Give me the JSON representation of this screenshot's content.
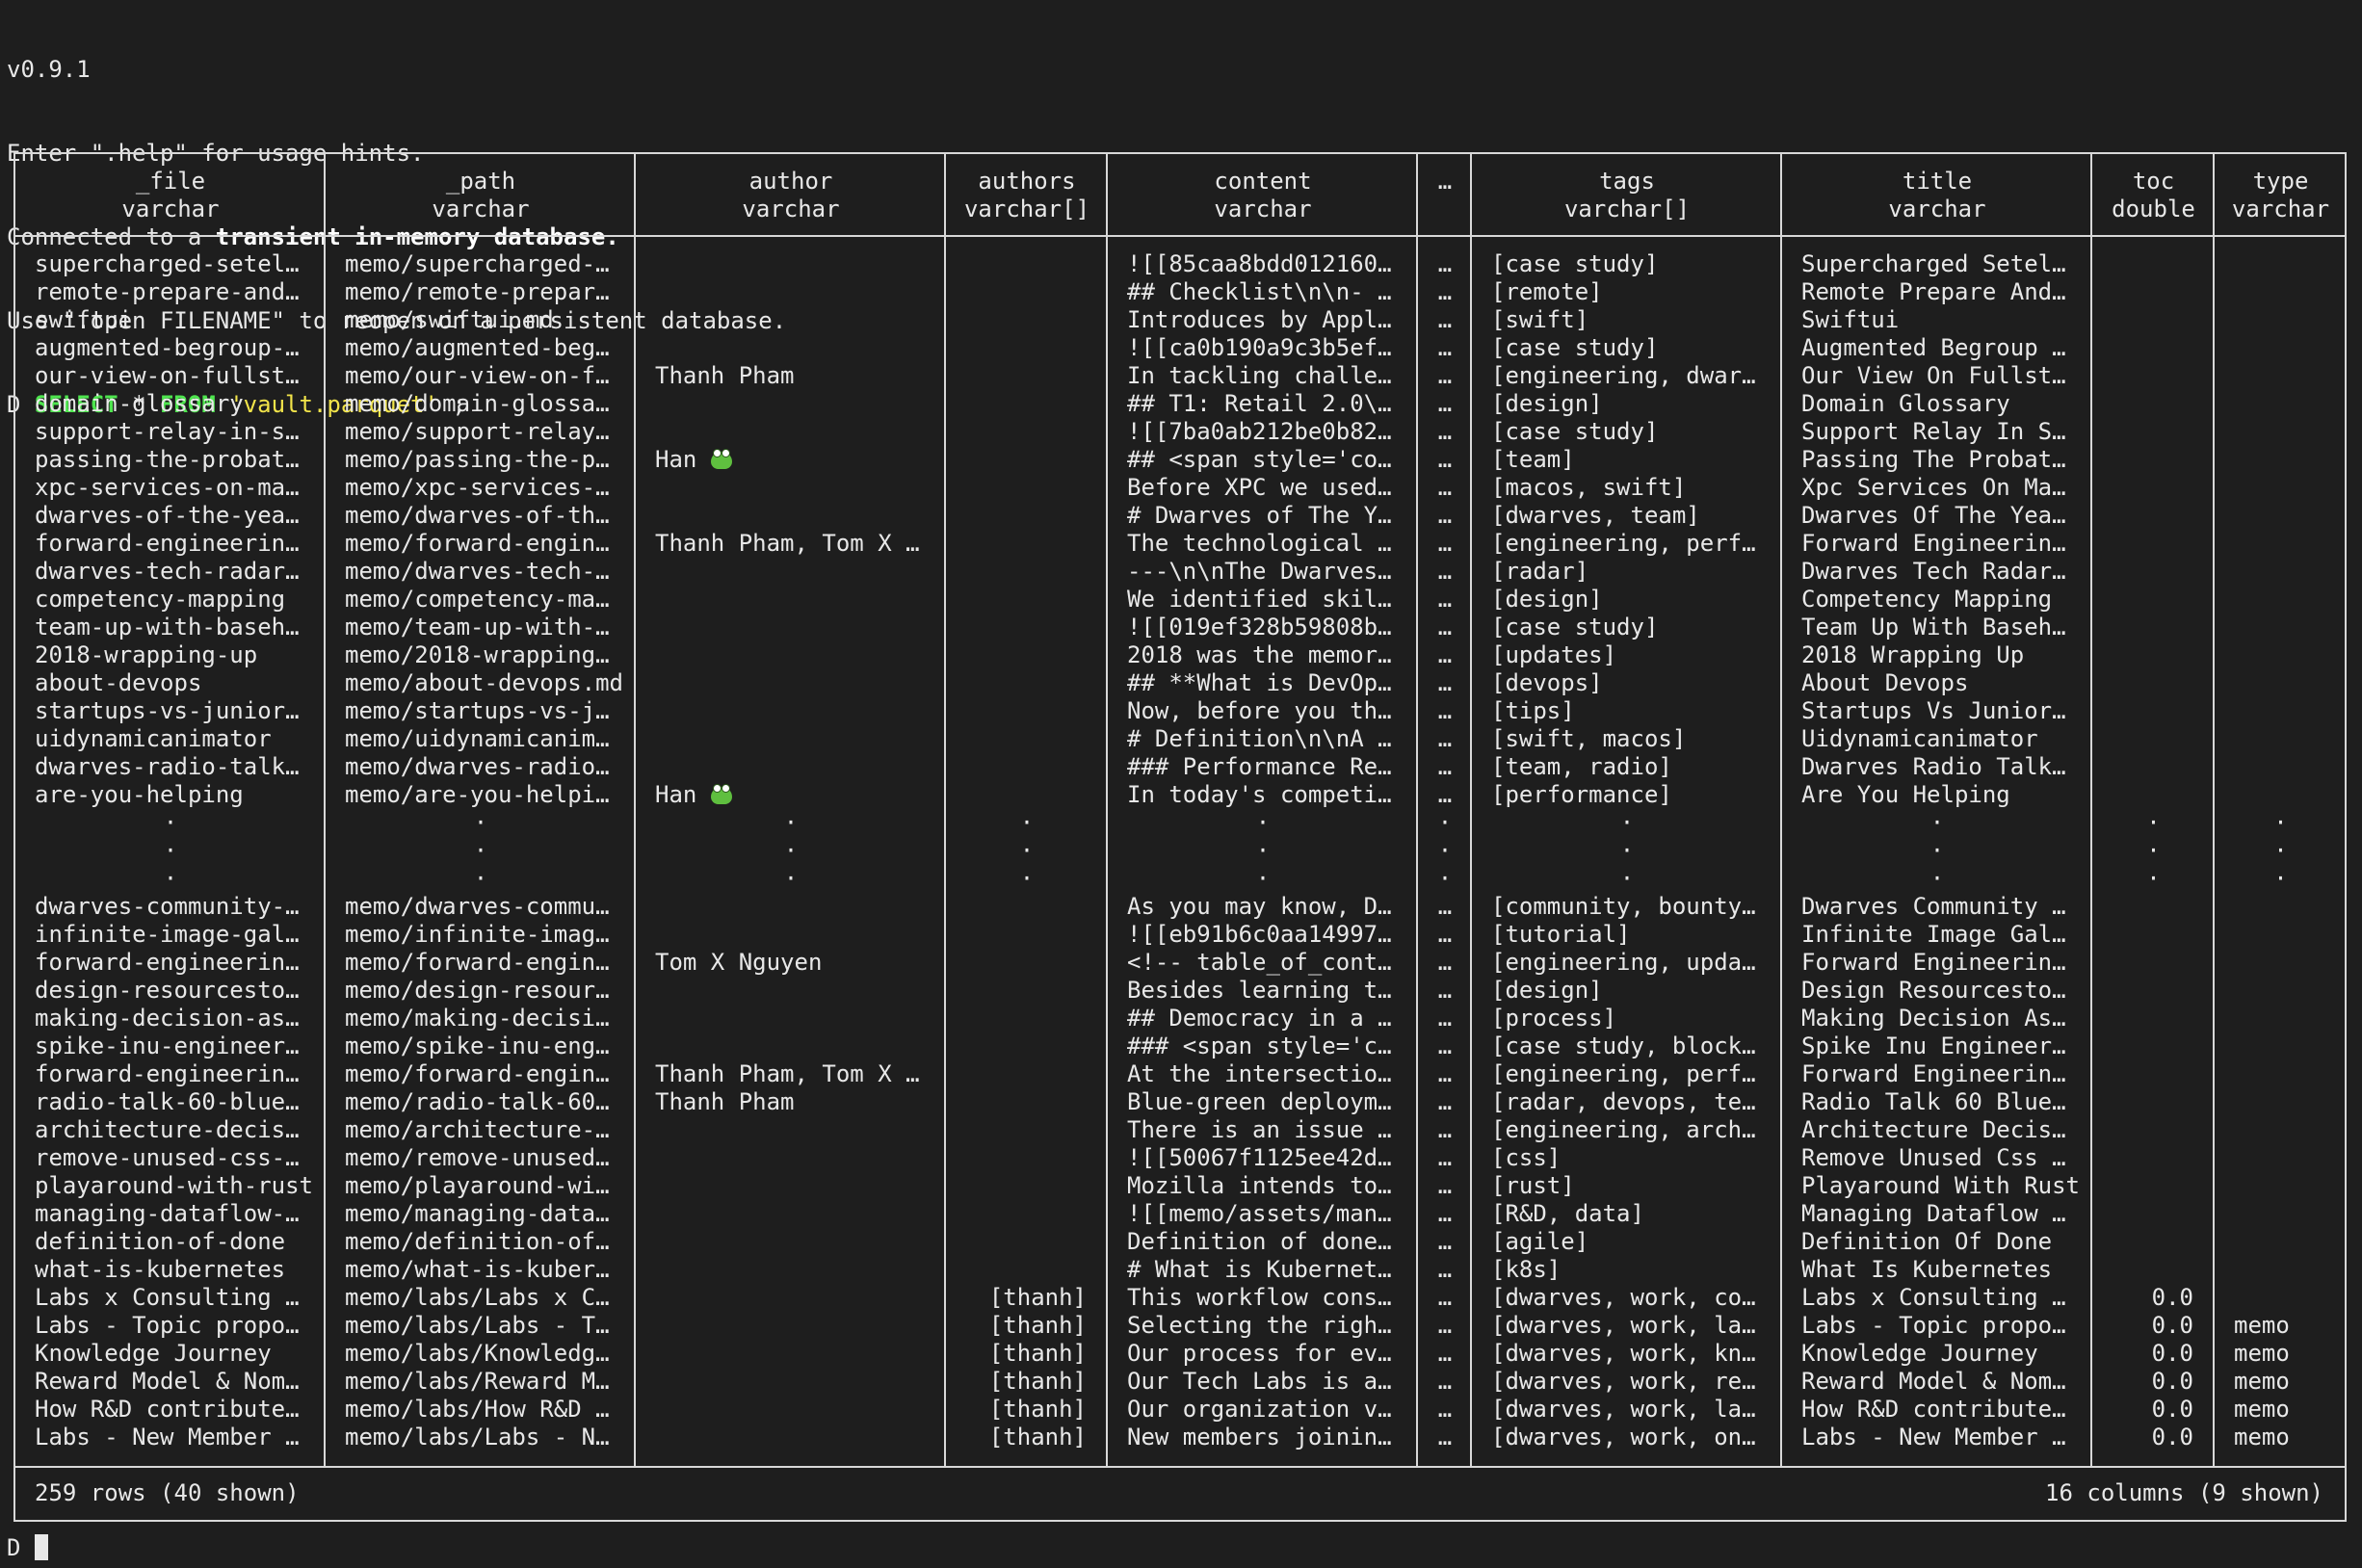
{
  "banner": {
    "version": "v0.9.1",
    "help_line": "Enter \".help\" for usage hints.",
    "connected_prefix": "Connected to a ",
    "connected_bold": "transient in-memory database.",
    "use_line": "Use \".open FILENAME\" to reopen on a persistent database."
  },
  "query": {
    "prompt": "D",
    "kw_select": "SELECT",
    "star": "*",
    "kw_from": "FROM",
    "table": "'vault.parquet'",
    "terminator": ";"
  },
  "columns": [
    {
      "name": "_file",
      "type": "varchar"
    },
    {
      "name": "_path",
      "type": "varchar"
    },
    {
      "name": "author",
      "type": "varchar"
    },
    {
      "name": "authors",
      "type": "varchar[]"
    },
    {
      "name": "content",
      "type": "varchar"
    },
    {
      "name": "…",
      "type": ""
    },
    {
      "name": "tags",
      "type": "varchar[]"
    },
    {
      "name": "title",
      "type": "varchar"
    },
    {
      "name": "toc",
      "type": "double"
    },
    {
      "name": "type",
      "type": "varchar"
    }
  ],
  "rows_top": [
    {
      "file": "supercharged-setel…",
      "path": "memo/supercharged-…",
      "author": "",
      "authors": "",
      "content": "![[85caa8bdd012160…",
      "ell": "…",
      "tags": "[case study]",
      "title": "Supercharged Setel…",
      "toc": "",
      "type": ""
    },
    {
      "file": "remote-prepare-and…",
      "path": "memo/remote-prepar…",
      "author": "",
      "authors": "",
      "content": "## Checklist\\n\\n- …",
      "ell": "…",
      "tags": "[remote]",
      "title": "Remote Prepare And…",
      "toc": "",
      "type": ""
    },
    {
      "file": "swiftui",
      "path": "memo/swiftui.md",
      "author": "",
      "authors": "",
      "content": "Introduces by Appl…",
      "ell": "…",
      "tags": "[swift]",
      "title": "Swiftui",
      "toc": "",
      "type": ""
    },
    {
      "file": "augmented-begroup-…",
      "path": "memo/augmented-beg…",
      "author": "",
      "authors": "",
      "content": "![[ca0b190a9c3b5ef…",
      "ell": "…",
      "tags": "[case study]",
      "title": "Augmented Begroup …",
      "toc": "",
      "type": ""
    },
    {
      "file": "our-view-on-fullst…",
      "path": "memo/our-view-on-f…",
      "author": "Thanh Pham",
      "authors": "",
      "content": "In tackling challe…",
      "ell": "…",
      "tags": "[engineering, dwar…",
      "title": "Our View On Fullst…",
      "toc": "",
      "type": ""
    },
    {
      "file": "domain-glossary",
      "path": "memo/domain-glossa…",
      "author": "",
      "authors": "",
      "content": "## T1: Retail 2.0\\…",
      "ell": "…",
      "tags": "[design]",
      "title": "Domain Glossary",
      "toc": "",
      "type": ""
    },
    {
      "file": "support-relay-in-s…",
      "path": "memo/support-relay…",
      "author": "",
      "authors": "",
      "content": "![[7ba0ab212be0b82…",
      "ell": "…",
      "tags": "[case study]",
      "title": "Support Relay In S…",
      "toc": "",
      "type": ""
    },
    {
      "file": "passing-the-probat…",
      "path": "memo/passing-the-p…",
      "author": "Han",
      "frog": true,
      "authors": "",
      "content": "## <span style='co…",
      "ell": "…",
      "tags": "[team]",
      "title": "Passing The Probat…",
      "toc": "",
      "type": ""
    },
    {
      "file": "xpc-services-on-ma…",
      "path": "memo/xpc-services-…",
      "author": "",
      "authors": "",
      "content": "Before XPC we used…",
      "ell": "…",
      "tags": "[macos, swift]",
      "title": "Xpc Services On Ma…",
      "toc": "",
      "type": ""
    },
    {
      "file": "dwarves-of-the-yea…",
      "path": "memo/dwarves-of-th…",
      "author": "",
      "authors": "",
      "content": "# Dwarves of The Y…",
      "ell": "…",
      "tags": "[dwarves, team]",
      "title": "Dwarves Of The Yea…",
      "toc": "",
      "type": ""
    },
    {
      "file": "forward-engineerin…",
      "path": "memo/forward-engin…",
      "author": "Thanh Pham, Tom X …",
      "authors": "",
      "content": "The technological …",
      "ell": "…",
      "tags": "[engineering, perf…",
      "title": "Forward Engineerin…",
      "toc": "",
      "type": ""
    },
    {
      "file": "dwarves-tech-radar…",
      "path": "memo/dwarves-tech-…",
      "author": "",
      "authors": "",
      "content": "---\\n\\nThe Dwarves…",
      "ell": "…",
      "tags": "[radar]",
      "title": "Dwarves Tech Radar…",
      "toc": "",
      "type": ""
    },
    {
      "file": "competency-mapping",
      "path": "memo/competency-ma…",
      "author": "",
      "authors": "",
      "content": "We identified skil…",
      "ell": "…",
      "tags": "[design]",
      "title": "Competency Mapping",
      "toc": "",
      "type": ""
    },
    {
      "file": "team-up-with-baseh…",
      "path": "memo/team-up-with-…",
      "author": "",
      "authors": "",
      "content": "![[019ef328b59808b…",
      "ell": "…",
      "tags": "[case study]",
      "title": "Team Up With Baseh…",
      "toc": "",
      "type": ""
    },
    {
      "file": "2018-wrapping-up",
      "path": "memo/2018-wrapping…",
      "author": "",
      "authors": "",
      "content": "2018 was the memor…",
      "ell": "…",
      "tags": "[updates]",
      "title": "2018 Wrapping Up",
      "toc": "",
      "type": ""
    },
    {
      "file": "about-devops",
      "path": "memo/about-devops.md",
      "author": "",
      "authors": "",
      "content": "## **What is DevOp…",
      "ell": "…",
      "tags": "[devops]",
      "title": "About Devops",
      "toc": "",
      "type": ""
    },
    {
      "file": "startups-vs-junior…",
      "path": "memo/startups-vs-j…",
      "author": "",
      "authors": "",
      "content": "Now, before you th…",
      "ell": "…",
      "tags": "[tips]",
      "title": "Startups Vs Junior…",
      "toc": "",
      "type": ""
    },
    {
      "file": "uidynamicanimator",
      "path": "memo/uidynamicanim…",
      "author": "",
      "authors": "",
      "content": "# Definition\\n\\nA …",
      "ell": "…",
      "tags": "[swift, macos]",
      "title": "Uidynamicanimator",
      "toc": "",
      "type": ""
    },
    {
      "file": "dwarves-radio-talk…",
      "path": "memo/dwarves-radio…",
      "author": "",
      "authors": "",
      "content": "### Performance Re…",
      "ell": "…",
      "tags": "[team, radio]",
      "title": "Dwarves Radio Talk…",
      "toc": "",
      "type": ""
    },
    {
      "file": "are-you-helping",
      "path": "memo/are-you-helpi…",
      "author": "Han",
      "frog": true,
      "authors": "",
      "content": "In today's competi…",
      "ell": "…",
      "tags": "[performance]",
      "title": "Are You Helping",
      "toc": "",
      "type": ""
    }
  ],
  "rows_bottom": [
    {
      "file": "dwarves-community-…",
      "path": "memo/dwarves-commu…",
      "author": "",
      "authors": "",
      "content": "As you may know, D…",
      "ell": "…",
      "tags": "[community, bounty…",
      "title": "Dwarves Community …",
      "toc": "",
      "type": ""
    },
    {
      "file": "infinite-image-gal…",
      "path": "memo/infinite-imag…",
      "author": "",
      "authors": "",
      "content": "![[eb91b6c0aa14997…",
      "ell": "…",
      "tags": "[tutorial]",
      "title": "Infinite Image Gal…",
      "toc": "",
      "type": ""
    },
    {
      "file": "forward-engineerin…",
      "path": "memo/forward-engin…",
      "author": "Tom X Nguyen",
      "authors": "",
      "content": "<!-- table_of_cont…",
      "ell": "…",
      "tags": "[engineering, upda…",
      "title": "Forward Engineerin…",
      "toc": "",
      "type": ""
    },
    {
      "file": "design-resourcesto…",
      "path": "memo/design-resour…",
      "author": "",
      "authors": "",
      "content": "Besides learning t…",
      "ell": "…",
      "tags": "[design]",
      "title": "Design Resourcesto…",
      "toc": "",
      "type": ""
    },
    {
      "file": "making-decision-as…",
      "path": "memo/making-decisi…",
      "author": "",
      "authors": "",
      "content": "## Democracy in a …",
      "ell": "…",
      "tags": "[process]",
      "title": "Making Decision As…",
      "toc": "",
      "type": ""
    },
    {
      "file": "spike-inu-engineer…",
      "path": "memo/spike-inu-eng…",
      "author": "",
      "authors": "",
      "content": "### <span style='c…",
      "ell": "…",
      "tags": "[case study, block…",
      "title": "Spike Inu Engineer…",
      "toc": "",
      "type": ""
    },
    {
      "file": "forward-engineerin…",
      "path": "memo/forward-engin…",
      "author": "Thanh Pham, Tom X …",
      "authors": "",
      "content": "At the intersectio…",
      "ell": "…",
      "tags": "[engineering, perf…",
      "title": "Forward Engineerin…",
      "toc": "",
      "type": ""
    },
    {
      "file": "radio-talk-60-blue…",
      "path": "memo/radio-talk-60…",
      "author": "Thanh Pham",
      "authors": "",
      "content": "Blue-green deploym…",
      "ell": "…",
      "tags": "[radar, devops, te…",
      "title": "Radio Talk 60 Blue…",
      "toc": "",
      "type": ""
    },
    {
      "file": "architecture-decis…",
      "path": "memo/architecture-…",
      "author": "",
      "authors": "",
      "content": "There is an issue …",
      "ell": "…",
      "tags": "[engineering, arch…",
      "title": "Architecture Decis…",
      "toc": "",
      "type": ""
    },
    {
      "file": "remove-unused-css-…",
      "path": "memo/remove-unused…",
      "author": "",
      "authors": "",
      "content": "![[50067f1125ee42d…",
      "ell": "…",
      "tags": "[css]",
      "title": "Remove Unused Css …",
      "toc": "",
      "type": ""
    },
    {
      "file": "playaround-with-rust",
      "path": "memo/playaround-wi…",
      "author": "",
      "authors": "",
      "content": "Mozilla intends to…",
      "ell": "…",
      "tags": "[rust]",
      "title": "Playaround With Rust",
      "toc": "",
      "type": ""
    },
    {
      "file": "managing-dataflow-…",
      "path": "memo/managing-data…",
      "author": "",
      "authors": "",
      "content": "![[memo/assets/man…",
      "ell": "…",
      "tags": "[R&D, data]",
      "title": "Managing Dataflow …",
      "toc": "",
      "type": ""
    },
    {
      "file": "definition-of-done",
      "path": "memo/definition-of…",
      "author": "",
      "authors": "",
      "content": "Definition of done…",
      "ell": "…",
      "tags": "[agile]",
      "title": "Definition Of Done",
      "toc": "",
      "type": ""
    },
    {
      "file": "what-is-kubernetes",
      "path": "memo/what-is-kuber…",
      "author": "",
      "authors": "",
      "content": "# What is Kubernet…",
      "ell": "…",
      "tags": "[k8s]",
      "title": "What Is Kubernetes",
      "toc": "",
      "type": ""
    },
    {
      "file": "Labs x Consulting …",
      "path": "memo/labs/Labs x C…",
      "author": "",
      "authors": "[thanh]",
      "content": "This workflow cons…",
      "ell": "…",
      "tags": "[dwarves, work, co…",
      "title": "Labs x Consulting …",
      "toc": "0.0",
      "type": ""
    },
    {
      "file": "Labs - Topic propo…",
      "path": "memo/labs/Labs - T…",
      "author": "",
      "authors": "[thanh]",
      "content": "Selecting the righ…",
      "ell": "…",
      "tags": "[dwarves, work, la…",
      "title": "Labs - Topic propo…",
      "toc": "0.0",
      "type": "memo"
    },
    {
      "file": "Knowledge Journey",
      "path": "memo/labs/Knowledg…",
      "author": "",
      "authors": "[thanh]",
      "content": "Our process for ev…",
      "ell": "…",
      "tags": "[dwarves, work, kn…",
      "title": "Knowledge Journey",
      "toc": "0.0",
      "type": "memo"
    },
    {
      "file": "Reward Model & Nom…",
      "path": "memo/labs/Reward M…",
      "author": "",
      "authors": "[thanh]",
      "content": "Our Tech Labs is a…",
      "ell": "…",
      "tags": "[dwarves, work, re…",
      "title": "Reward Model & Nom…",
      "toc": "0.0",
      "type": "memo"
    },
    {
      "file": "How R&D contribute…",
      "path": "memo/labs/How R&D …",
      "author": "",
      "authors": "[thanh]",
      "content": "Our organization v…",
      "ell": "…",
      "tags": "[dwarves, work, la…",
      "title": "How R&D contribute…",
      "toc": "0.0",
      "type": "memo"
    },
    {
      "file": "Labs - New Member …",
      "path": "memo/labs/Labs - N…",
      "author": "",
      "authors": "[thanh]",
      "content": "New members joinin…",
      "ell": "…",
      "tags": "[dwarves, work, on…",
      "title": "Labs - New Member …",
      "toc": "0.0",
      "type": "memo"
    }
  ],
  "elision_dot": "·",
  "footer": {
    "rows_info": "259 rows (40 shown)",
    "cols_info": "16 columns (9 shown)"
  },
  "prompt_bottom": "D",
  "icons": {
    "frog": "frog-emoji-icon",
    "cursor": "block-cursor"
  }
}
